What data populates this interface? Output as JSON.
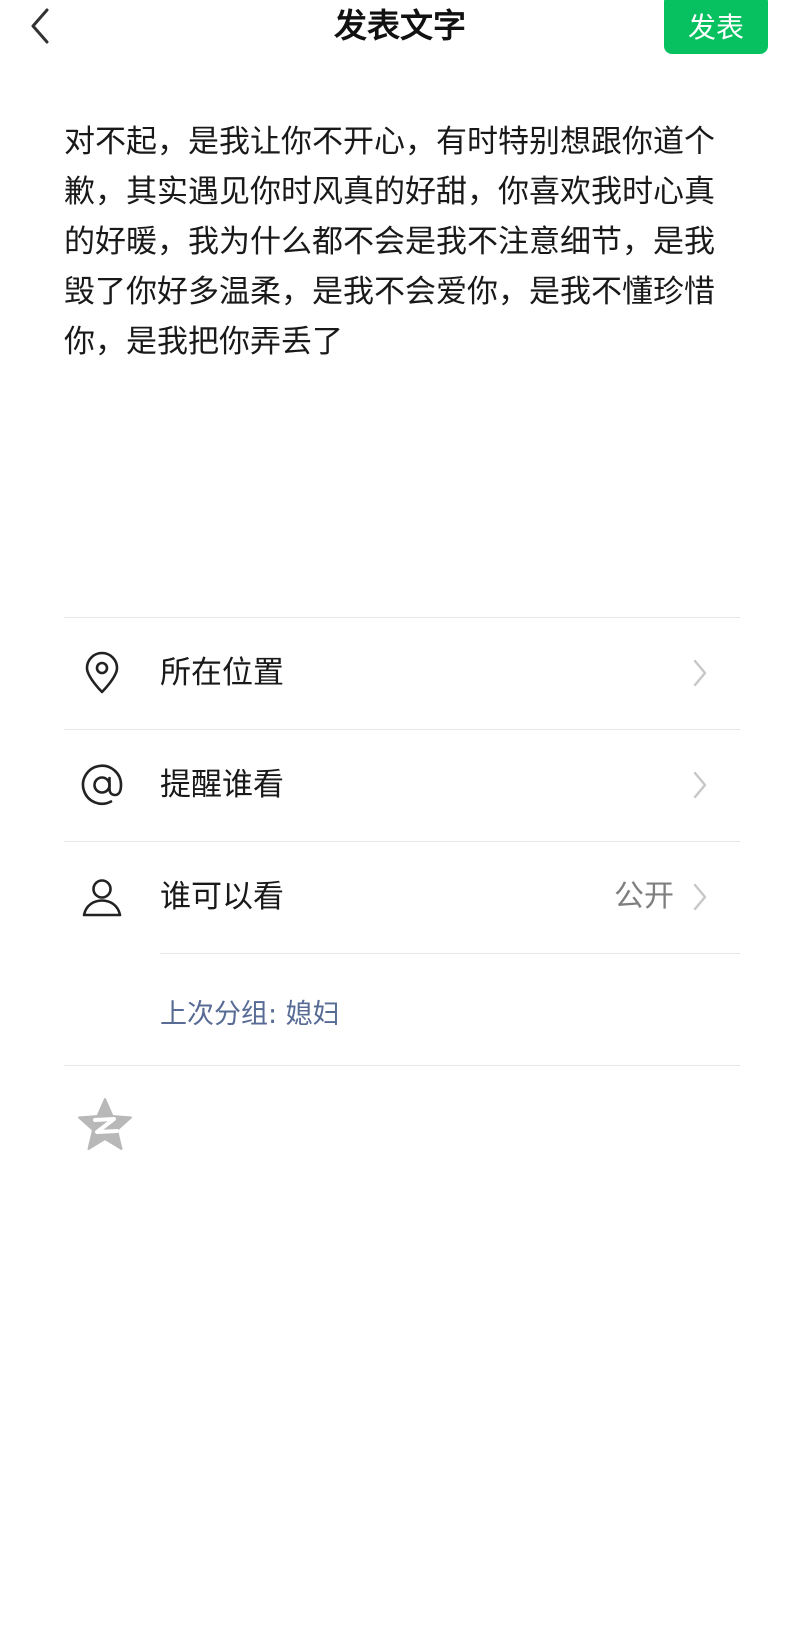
{
  "header": {
    "title": "发表文字",
    "publish_label": "发表"
  },
  "post": {
    "text": "对不起，是我让你不开心，有时特别想跟你道个歉，其实遇见你时风真的好甜，你喜欢我时心真的好暖，我为什么都不会是我不注意细节，是我毁了你好多温柔，是我不会爱你，是我不懂珍惜你，是我把你弄丢了"
  },
  "options": {
    "location": {
      "label": "所在位置",
      "icon": "location-pin-icon"
    },
    "mention": {
      "label": "提醒谁看",
      "icon": "at-sign-icon"
    },
    "visibility": {
      "label": "谁可以看",
      "value": "公开",
      "icon": "person-icon"
    },
    "last_group": "上次分组: 媳妇"
  },
  "footer": {
    "icon": "qzone-star-icon"
  },
  "colors": {
    "accent": "#07c160",
    "link": "#576b95",
    "divider": "#e7e7e7",
    "secondary_text": "#7f7f7f"
  }
}
